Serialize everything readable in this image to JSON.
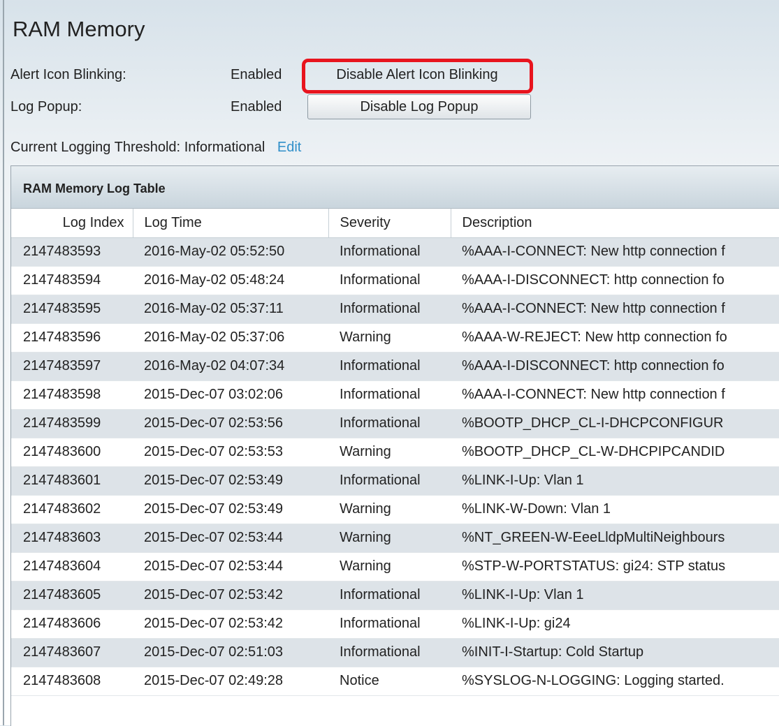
{
  "page": {
    "title": "RAM Memory"
  },
  "settings": {
    "alert_icon": {
      "label": "Alert Icon Blinking:",
      "status": "Enabled",
      "button": "Disable Alert Icon Blinking"
    },
    "log_popup": {
      "label": "Log Popup:",
      "status": "Enabled",
      "button": "Disable Log Popup"
    },
    "threshold": {
      "label": "Current Logging Threshold:",
      "value": "Informational",
      "edit": "Edit"
    }
  },
  "colors": {
    "highlight": "#e8141e",
    "link": "#2f8fc9",
    "stripe": "#dde3e8"
  },
  "table": {
    "caption": "RAM Memory Log Table",
    "columns": [
      "Log Index",
      "Log Time",
      "Severity",
      "Description"
    ],
    "rows": [
      [
        "2147483593",
        "2016-May-02 05:52:50",
        "Informational",
        "%AAA-I-CONNECT: New http connection f"
      ],
      [
        "2147483594",
        "2016-May-02 05:48:24",
        "Informational",
        "%AAA-I-DISCONNECT: http connection fo"
      ],
      [
        "2147483595",
        "2016-May-02 05:37:11",
        "Informational",
        "%AAA-I-CONNECT: New http connection f"
      ],
      [
        "2147483596",
        "2016-May-02 05:37:06",
        "Warning",
        "%AAA-W-REJECT: New http connection fo"
      ],
      [
        "2147483597",
        "2016-May-02 04:07:34",
        "Informational",
        "%AAA-I-DISCONNECT: http connection fo"
      ],
      [
        "2147483598",
        "2015-Dec-07 03:02:06",
        "Informational",
        "%AAA-I-CONNECT: New http connection f"
      ],
      [
        "2147483599",
        "2015-Dec-07 02:53:56",
        "Informational",
        "%BOOTP_DHCP_CL-I-DHCPCONFIGUR"
      ],
      [
        "2147483600",
        "2015-Dec-07 02:53:53",
        "Warning",
        "%BOOTP_DHCP_CL-W-DHCPIPCANDID"
      ],
      [
        "2147483601",
        "2015-Dec-07 02:53:49",
        "Informational",
        "%LINK-I-Up:  Vlan 1"
      ],
      [
        "2147483602",
        "2015-Dec-07 02:53:49",
        "Warning",
        "%LINK-W-Down:  Vlan 1"
      ],
      [
        "2147483603",
        "2015-Dec-07 02:53:44",
        "Warning",
        "%NT_GREEN-W-EeeLldpMultiNeighbours"
      ],
      [
        "2147483604",
        "2015-Dec-07 02:53:44",
        "Warning",
        "%STP-W-PORTSTATUS: gi24: STP status"
      ],
      [
        "2147483605",
        "2015-Dec-07 02:53:42",
        "Informational",
        "%LINK-I-Up:  Vlan 1"
      ],
      [
        "2147483606",
        "2015-Dec-07 02:53:42",
        "Informational",
        "%LINK-I-Up:  gi24"
      ],
      [
        "2147483607",
        "2015-Dec-07 02:51:03",
        "Informational",
        "%INIT-I-Startup: Cold Startup"
      ],
      [
        "2147483608",
        "2015-Dec-07 02:49:28",
        "Notice",
        "%SYSLOG-N-LOGGING: Logging started."
      ]
    ]
  }
}
